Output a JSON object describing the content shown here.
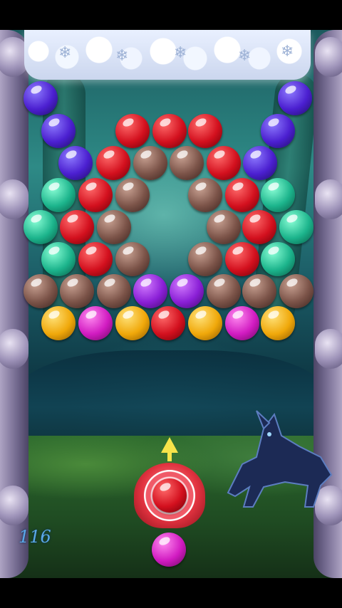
{
  "game": {
    "shots_remaining": "116",
    "current_bubble": "red",
    "next_bubble": "magenta"
  },
  "board": {
    "rows": [
      [
        "purple",
        null,
        null,
        null,
        null,
        null,
        null,
        null,
        "purple"
      ],
      [
        "purple",
        null,
        "red",
        "red",
        "red",
        null,
        "purple"
      ],
      [
        "purple",
        "red",
        "brown",
        "brown",
        "red",
        "purple"
      ],
      [
        "green",
        "red",
        "brown",
        null,
        "brown",
        "red",
        "green"
      ],
      [
        "green",
        "red",
        "brown",
        null,
        "brown",
        "red",
        "green"
      ],
      [
        "green",
        "red",
        "brown",
        null,
        "brown",
        "red",
        "green"
      ],
      [
        "brown",
        "brown",
        "brown",
        "violet",
        "violet",
        "brown",
        "brown",
        "brown"
      ],
      [
        "yellow",
        "magenta",
        "yellow",
        "red",
        "yellow",
        "magenta",
        "yellow"
      ]
    ]
  },
  "colors": {
    "purple": "#4b1fd0",
    "red": "#d3101e",
    "brown": "#7b5348",
    "green": "#1cb48c",
    "violet": "#8a1fd6",
    "yellow": "#f0a80a",
    "magenta": "#d11bc1"
  },
  "icons": {
    "aim_arrow": "arrow-up-icon",
    "ceiling": "snowflake-icon"
  }
}
